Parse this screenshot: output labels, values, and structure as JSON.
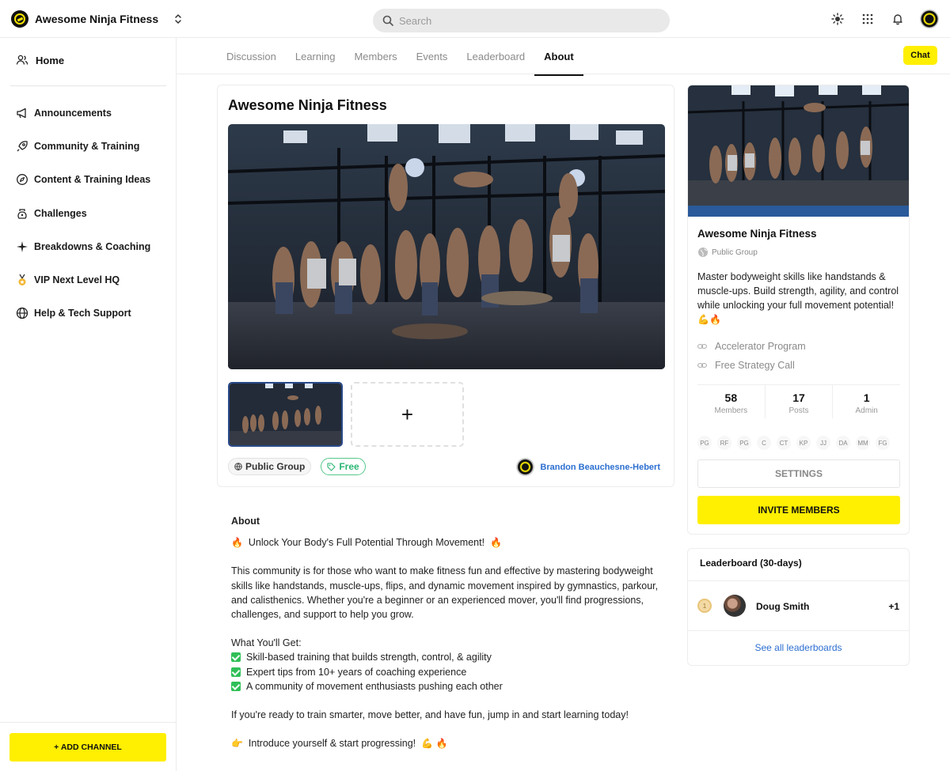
{
  "header": {
    "brand": "Awesome Ninja Fitness",
    "search_placeholder": "Search"
  },
  "sidebar": {
    "home": "Home",
    "items": [
      {
        "label": "Announcements",
        "icon": "megaphone-icon"
      },
      {
        "label": "Community & Training",
        "icon": "rocket-icon"
      },
      {
        "label": "Content & Training Ideas",
        "icon": "compass-icon"
      },
      {
        "label": "Challenges",
        "icon": "kettlebell-icon"
      },
      {
        "label": "Breakdowns & Coaching",
        "icon": "sparkle-icon"
      },
      {
        "label": "VIP Next Level HQ",
        "icon": "medal-icon"
      },
      {
        "label": "Help & Tech Support",
        "icon": "globe-icon"
      }
    ],
    "add_channel": "+ ADD CHANNEL"
  },
  "tabs": {
    "items": [
      "Discussion",
      "Learning",
      "Members",
      "Events",
      "Leaderboard",
      "About"
    ],
    "active": "About",
    "chat": "Chat"
  },
  "main": {
    "title": "Awesome Ninja Fitness",
    "add_media_symbol": "+",
    "public_group": "Public Group",
    "price": "Free",
    "owner": "Brandon Beauchesne-Hebert"
  },
  "about": {
    "heading": "About",
    "headline": "Unlock Your Body's Full Potential Through Movement!",
    "intro": "This community is for those who want to make fitness fun and effective by mastering bodyweight skills like handstands, muscle-ups, flips, and dynamic movement inspired by gymnastics, parkour, and calisthenics. Whether you're a beginner or an experienced mover, you'll find progressions, challenges, and support to help you grow.",
    "get_heading": "What You'll Get:",
    "benefits": [
      "Skill-based training that builds strength, control, & agility",
      "Expert tips from 10+ years of coaching experience",
      "A community of movement enthusiasts pushing each other"
    ],
    "cta": "If you're ready to train smarter, move better, and have fun, jump in and start learning today!",
    "closing": "Introduce yourself & start progressing!"
  },
  "group_card": {
    "title": "Awesome Ninja Fitness",
    "type": "Public Group",
    "description": "Master bodyweight skills like handstands & muscle-ups. Build strength, agility, and control while unlocking your full movement potential!",
    "links": [
      "Accelerator Program",
      "Free Strategy Call"
    ],
    "stats": [
      {
        "value": "58",
        "label": "Members"
      },
      {
        "value": "17",
        "label": "Posts"
      },
      {
        "value": "1",
        "label": "Admin"
      }
    ],
    "member_initials": [
      "PG",
      "RF",
      "PG",
      "C",
      "CT",
      "KP",
      "JJ",
      "DA",
      "MM",
      "FG"
    ],
    "settings": "SETTINGS",
    "invite": "INVITE MEMBERS"
  },
  "leaderboard": {
    "title": "Leaderboard (30-days)",
    "rank": "1",
    "name": "Doug Smith",
    "score": "+1",
    "see_all": "See all leaderboards"
  },
  "colors": {
    "accent_yellow": "#ffef00",
    "link_blue": "#2c6fd1",
    "free_green": "#2bb673"
  }
}
